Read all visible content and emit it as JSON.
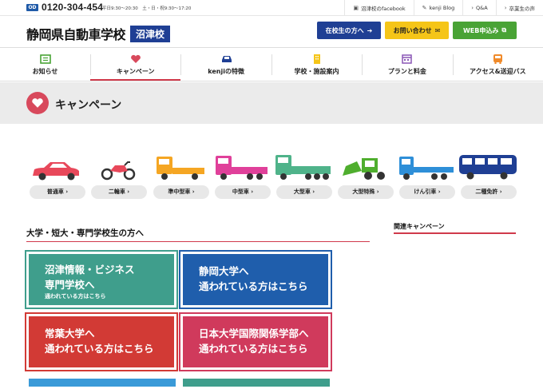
{
  "topbar": {
    "badge": "OD",
    "phone": "0120-304-454",
    "hours": "平日9:30〜20:30　土・日・祝9:30〜17:20",
    "links": [
      {
        "icon": "facebook-icon",
        "label": "沼津校のfacebook"
      },
      {
        "icon": "pencil-icon",
        "label": "kenji Blog"
      },
      {
        "icon": "question-icon",
        "label": "Q&A"
      },
      {
        "icon": "person-icon",
        "label": "卒業生の声"
      }
    ]
  },
  "header": {
    "logo_main": "静岡県自動車学校",
    "logo_sub": "沼津校",
    "buttons": [
      {
        "label": "在校生の方へ",
        "icon": "arrow-circle-icon"
      },
      {
        "label": "お問い合わせ",
        "icon": "mail-icon"
      },
      {
        "label": "WEB申込み",
        "icon": "external-icon"
      }
    ]
  },
  "nav": [
    {
      "label": "お知らせ",
      "icon": "news-icon",
      "color": "#49a335"
    },
    {
      "label": "キャンペーン",
      "icon": "heart-icon",
      "color": "#d8495c",
      "active": true
    },
    {
      "label": "kenjiの特徴",
      "icon": "car-icon",
      "color": "#1f3f94"
    },
    {
      "label": "学校・施設案内",
      "icon": "building-icon",
      "color": "#f5c518"
    },
    {
      "label": "プランと料金",
      "icon": "calendar-icon",
      "color": "#8a57b5"
    },
    {
      "label": "アクセス&送迎バス",
      "icon": "bus-icon",
      "color": "#f08a2a"
    }
  ],
  "banner": {
    "title": "キャンペーン"
  },
  "vehicles": [
    {
      "label": "普通車",
      "icon": "sedan-icon",
      "color": "#e8485a"
    },
    {
      "label": "二輪車",
      "icon": "motorcycle-icon",
      "color": "#e8485a"
    },
    {
      "label": "準中型車",
      "icon": "truck-icon",
      "color": "#f5a623"
    },
    {
      "label": "中型車",
      "icon": "truck-icon",
      "color": "#e0409a"
    },
    {
      "label": "大型車",
      "icon": "truck-icon",
      "color": "#4fb38a"
    },
    {
      "label": "大型特殊",
      "icon": "loader-icon",
      "color": "#4fae2e"
    },
    {
      "label": "けん引車",
      "icon": "trailer-icon",
      "color": "#2e8fd8"
    },
    {
      "label": "二種免許",
      "icon": "bus-icon",
      "color": "#1f3f94"
    }
  ],
  "vehicle_suffix": " ›",
  "section": {
    "title": "大学・短大・専門学校生の方へ"
  },
  "sidebar": {
    "title": "関連キャンペーン"
  },
  "cards": [
    {
      "line1": "沼津情報・ビジネス",
      "line2": "専門学校へ",
      "line3": "通われている方はこちら",
      "color": "#3f9e8c"
    },
    {
      "line1": "静岡大学へ",
      "line2": "通われている方はこちら",
      "color": "#1f5eac"
    },
    {
      "line1": "常葉大学へ",
      "line2": "通われている方はこちら",
      "color": "#d23a35"
    },
    {
      "line1": "日本大学国際関係学部へ",
      "line2": "通われている方はこちら",
      "color": "#d03a5c"
    }
  ]
}
